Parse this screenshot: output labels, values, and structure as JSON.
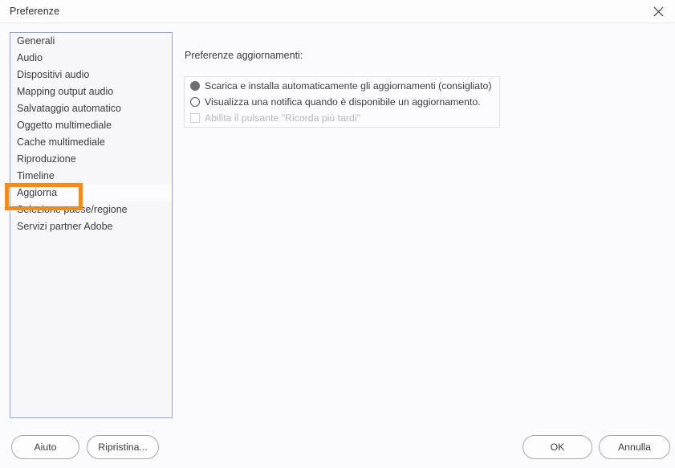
{
  "window": {
    "title": "Preferenze",
    "close_icon": "close-icon"
  },
  "sidebar": {
    "items": [
      {
        "label": "Generali",
        "selected": false
      },
      {
        "label": "Audio",
        "selected": false
      },
      {
        "label": "Dispositivi audio",
        "selected": false
      },
      {
        "label": "Mapping output audio",
        "selected": false
      },
      {
        "label": "Salvataggio automatico",
        "selected": false
      },
      {
        "label": "Oggetto multimediale",
        "selected": false
      },
      {
        "label": "Cache multimediale",
        "selected": false
      },
      {
        "label": "Riproduzione",
        "selected": false
      },
      {
        "label": "Timeline",
        "selected": false
      },
      {
        "label": "Aggiorna",
        "selected": true
      },
      {
        "label": "Selezione paese/regione",
        "selected": false
      },
      {
        "label": "Servizi partner Adobe",
        "selected": false
      }
    ]
  },
  "annotation": {
    "target_label": "Aggiorna",
    "color": "#f08c1b"
  },
  "main": {
    "section_label": "Preferenze aggiornamenti:",
    "options": [
      {
        "type": "radio",
        "label": "Scarica e installa automaticamente gli aggiornamenti (consigliato)",
        "checked": true,
        "disabled": false
      },
      {
        "type": "radio",
        "label": "Visualizza una notifica quando è disponibile un aggiornamento.",
        "checked": false,
        "disabled": false
      },
      {
        "type": "checkbox",
        "label": "Abilita il pulsante \"Ricorda più tardi\"",
        "checked": false,
        "disabled": true
      }
    ]
  },
  "footer": {
    "help_label": "Aiuto",
    "reset_label": "Ripristina...",
    "ok_label": "OK",
    "cancel_label": "Annulla"
  }
}
